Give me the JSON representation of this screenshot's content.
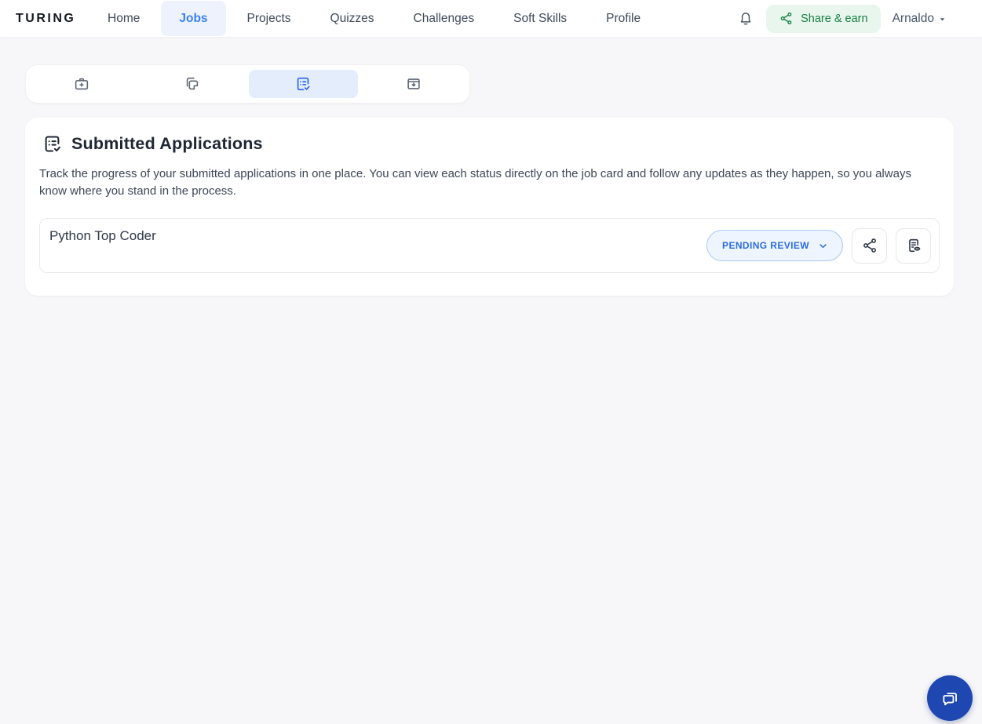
{
  "header": {
    "logo": "TURING",
    "nav": [
      {
        "label": "Home",
        "active": false
      },
      {
        "label": "Jobs",
        "active": true
      },
      {
        "label": "Projects",
        "active": false
      },
      {
        "label": "Quizzes",
        "active": false
      },
      {
        "label": "Challenges",
        "active": false
      },
      {
        "label": "Soft Skills",
        "active": false
      },
      {
        "label": "Profile",
        "active": false
      }
    ],
    "share_earn_label": "Share & earn",
    "user_name": "Arnaldo",
    "icons": [
      "bell-icon",
      "share-nodes-icon",
      "caret-down-icon"
    ]
  },
  "tabstrip": {
    "active_index": 2,
    "tabs": [
      {
        "icon": "briefcase-plus-icon"
      },
      {
        "icon": "copy-icon"
      },
      {
        "icon": "clipboard-list-check-icon"
      },
      {
        "icon": "box-arrow-down-icon"
      }
    ]
  },
  "main": {
    "title": "Submitted Applications",
    "title_icon": "clipboard-list-check-icon",
    "description": "Track the progress of your submitted applications in one place. You can view each status directly on the job card and follow any updates as they happen, so you always know where you stand in the process.",
    "applications": [
      {
        "job_title": "Python Top Coder",
        "status": "PENDING REVIEW",
        "action_icons": [
          "share-nodes-icon",
          "document-eye-icon"
        ]
      }
    ]
  },
  "chat_widget": {
    "icon": "chat-bubbles-icon"
  },
  "colors": {
    "page_bg": "#f7f7f9",
    "accent_blue": "#3b82f6",
    "nav_active_bg": "#edf2fc",
    "tab_active_bg": "#e3edfc",
    "tab_active_icon": "#2563eb",
    "green_text": "#178044",
    "green_bg": "#e9f6ee",
    "status_text": "#2b6cdf",
    "status_bg": "#eef5fe",
    "status_border": "#a7c9f2",
    "fab_bg": "#1f47b2"
  }
}
